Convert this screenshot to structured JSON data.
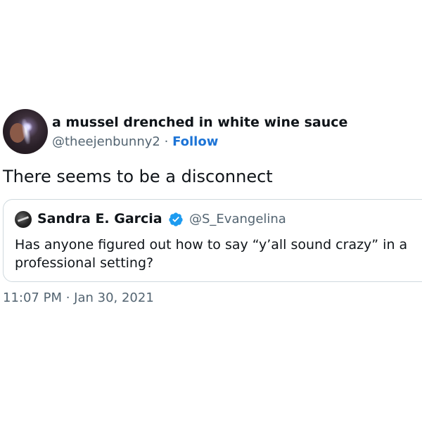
{
  "tweet": {
    "author": {
      "name": "a mussel drenched in white wine sauce",
      "handle": "@theejenbunny2",
      "separator": "·",
      "follow_label": "Follow"
    },
    "text": "There seems to be a disconnect",
    "quoted": {
      "author_name": "Sandra E. Garcia",
      "author_handle": "@S_Evangelina",
      "verified_icon": "verified-badge-icon",
      "line1": "Has anyone figured out how to say “y’all sound crazy” in a",
      "line2": "professional setting?"
    },
    "timestamp": "11:07 PM · Jan 30, 2021"
  },
  "colors": {
    "text": "#0f1419",
    "secondary": "#536471",
    "link": "#1d74d6",
    "verified": "#1d9bf0",
    "border": "#cfd9de"
  }
}
